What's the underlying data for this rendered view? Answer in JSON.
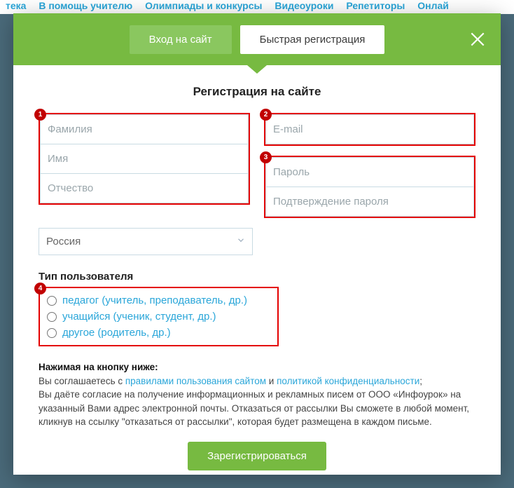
{
  "nav": [
    "тека",
    "В помощь учителю",
    "Олимпиады и конкурсы",
    "Видеоуроки",
    "Репетиторы",
    "Онлай"
  ],
  "tabs": {
    "login": "Вход на сайт",
    "register": "Быстрая регистрация"
  },
  "form": {
    "title": "Регистрация на сайте",
    "lastname_ph": "Фамилия",
    "firstname_ph": "Имя",
    "patronymic_ph": "Отчество",
    "email_ph": "E-mail",
    "password_ph": "Пароль",
    "password_confirm_ph": "Подтверждение пароля",
    "country": "Россия",
    "user_type_label": "Тип пользователя",
    "user_types": [
      "педагог (учитель, преподаватель, др.)",
      "учащийся (ученик, студент, др.)",
      "другое (родитель, др.)"
    ],
    "terms_heading": "Нажимая на кнопку ниже:",
    "terms_line1_a": "Вы соглашаетесь с ",
    "terms_link1": "правилами пользования сайтом",
    "terms_line1_b": " и ",
    "terms_link2": "политикой конфиденциальности",
    "terms_line1_c": ";",
    "terms_line2": "Вы даёте согласие на получение информационных и рекламных писем от ООО «Инфоурок» на указанный Вами адрес электронной почты. Отказаться от рассылки Вы сможете в любой момент, кликнув на ссылку \"отказаться от рассылки\", которая будет размещена в каждом письме.",
    "submit": "Зарегистрироваться"
  },
  "annotations": {
    "b1": "1",
    "b2": "2",
    "b3": "3",
    "b4": "4"
  }
}
